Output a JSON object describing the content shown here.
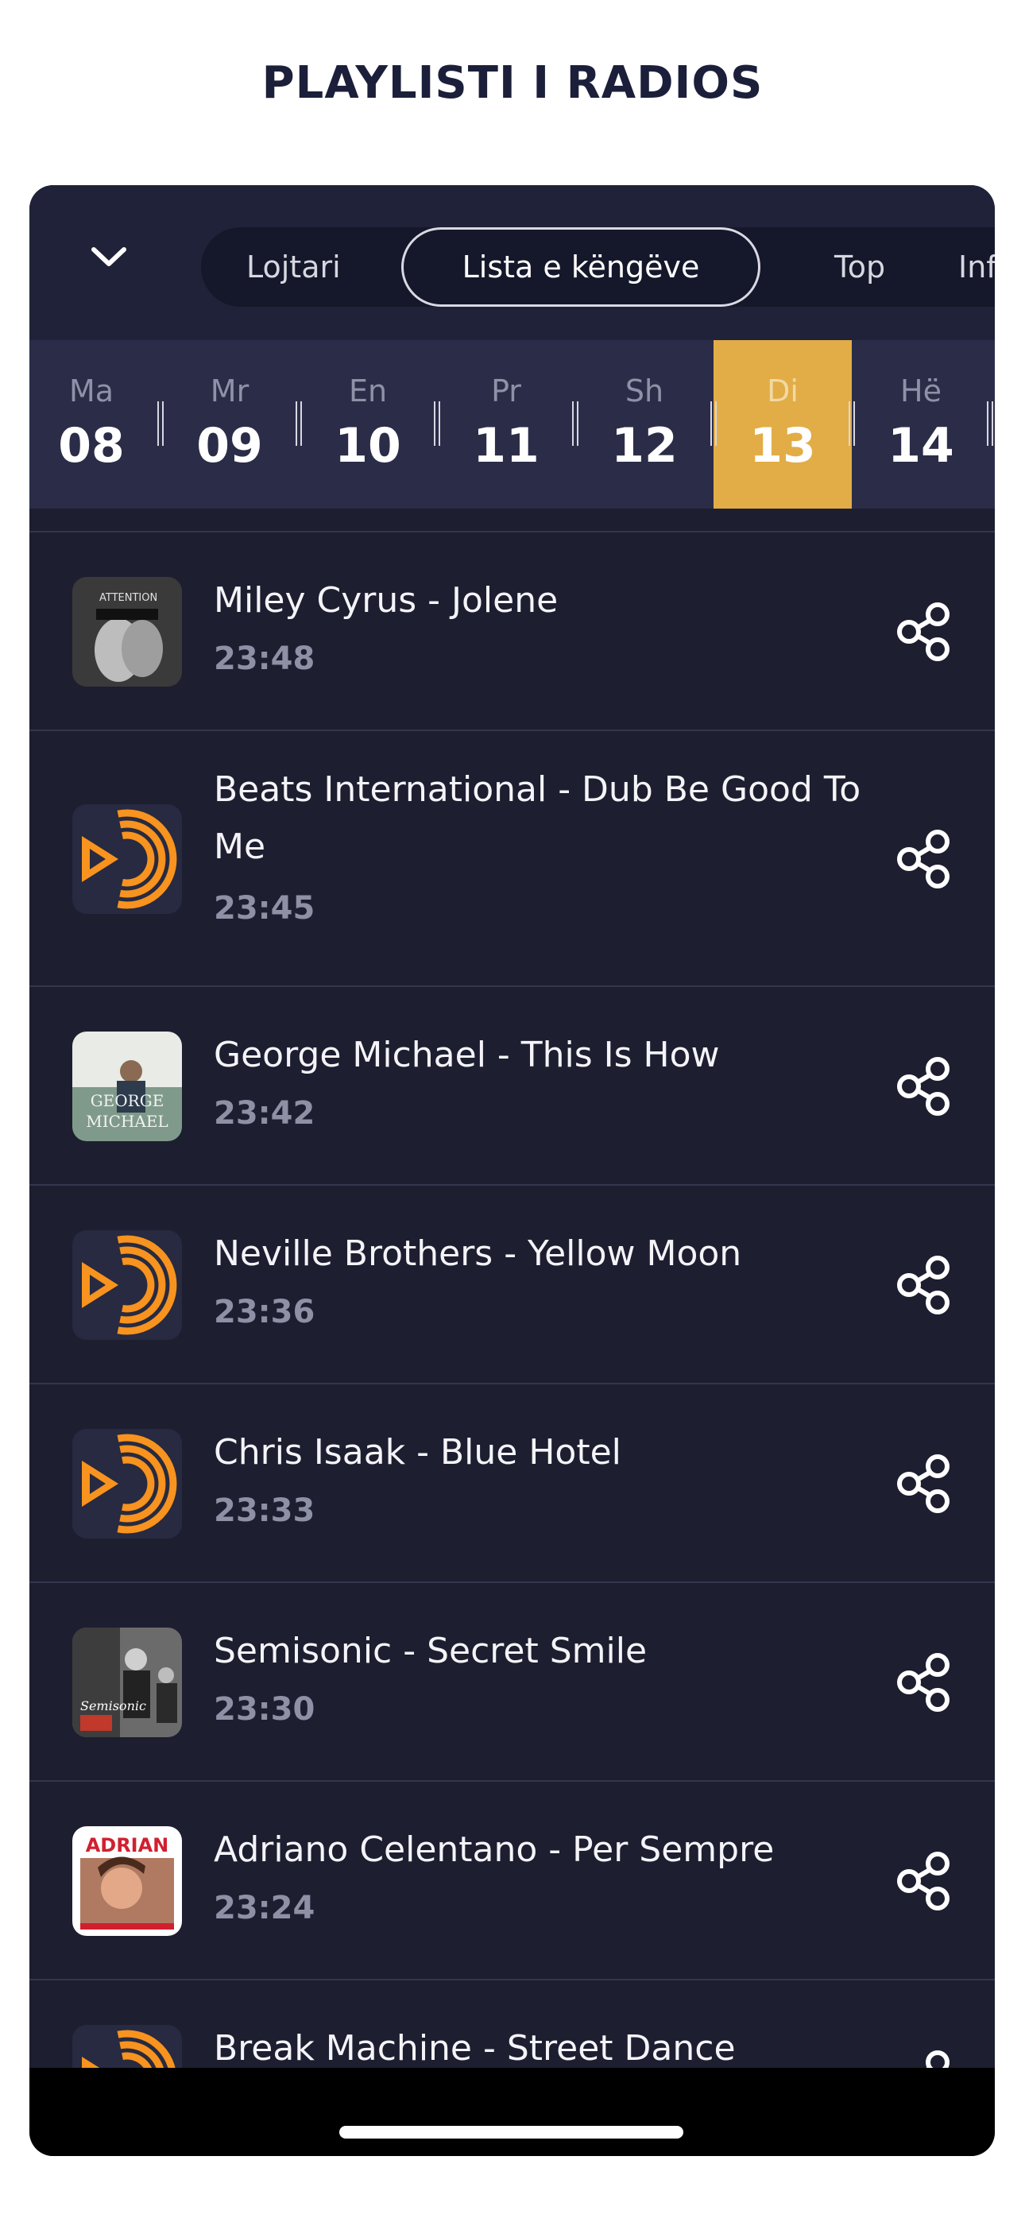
{
  "page": {
    "title": "PLAYLISTI I RADIOS"
  },
  "tabs": [
    {
      "label": "Lojtari",
      "active": false
    },
    {
      "label": "Lista e këngëve",
      "active": true
    },
    {
      "label": "Top",
      "active": false
    },
    {
      "label": "Inf",
      "active": false
    }
  ],
  "days": [
    {
      "name": "Ma",
      "num": "08",
      "selected": false
    },
    {
      "name": "Mr",
      "num": "09",
      "selected": false
    },
    {
      "name": "En",
      "num": "10",
      "selected": false
    },
    {
      "name": "Pr",
      "num": "11",
      "selected": false
    },
    {
      "name": "Sh",
      "num": "12",
      "selected": false
    },
    {
      "name": "Di",
      "num": "13",
      "selected": true
    },
    {
      "name": "Hë",
      "num": "14",
      "selected": false
    }
  ],
  "accent_color": "#e2ad47",
  "logo_color": "#f7931e",
  "tracks": [
    {
      "title": "Miley Cyrus - Jolene",
      "time": "23:48",
      "art": "attention-cover",
      "art_text": "ATTENTION"
    },
    {
      "title": "Beats International - Dub Be Good To Me",
      "time": "23:45",
      "art": "radio-logo"
    },
    {
      "title": "George Michael - This Is How",
      "time": "23:42",
      "art": "george-michael-cover",
      "art_text": "GEORGE MICHAEL"
    },
    {
      "title": "Neville Brothers - Yellow Moon",
      "time": "23:36",
      "art": "radio-logo"
    },
    {
      "title": "Chris Isaak - Blue Hotel",
      "time": "23:33",
      "art": "radio-logo"
    },
    {
      "title": "Semisonic - Secret Smile",
      "time": "23:30",
      "art": "semisonic-cover",
      "art_text": "Semisonic"
    },
    {
      "title": "Adriano Celentano - Per Sempre",
      "time": "23:24",
      "art": "adrian-cover",
      "art_text": "ADRIAN"
    },
    {
      "title": "Break Machine - Street Dance",
      "time": "",
      "art": "radio-logo"
    }
  ],
  "icons": {
    "collapse": "chevron-down-icon",
    "share": "share-icon"
  }
}
